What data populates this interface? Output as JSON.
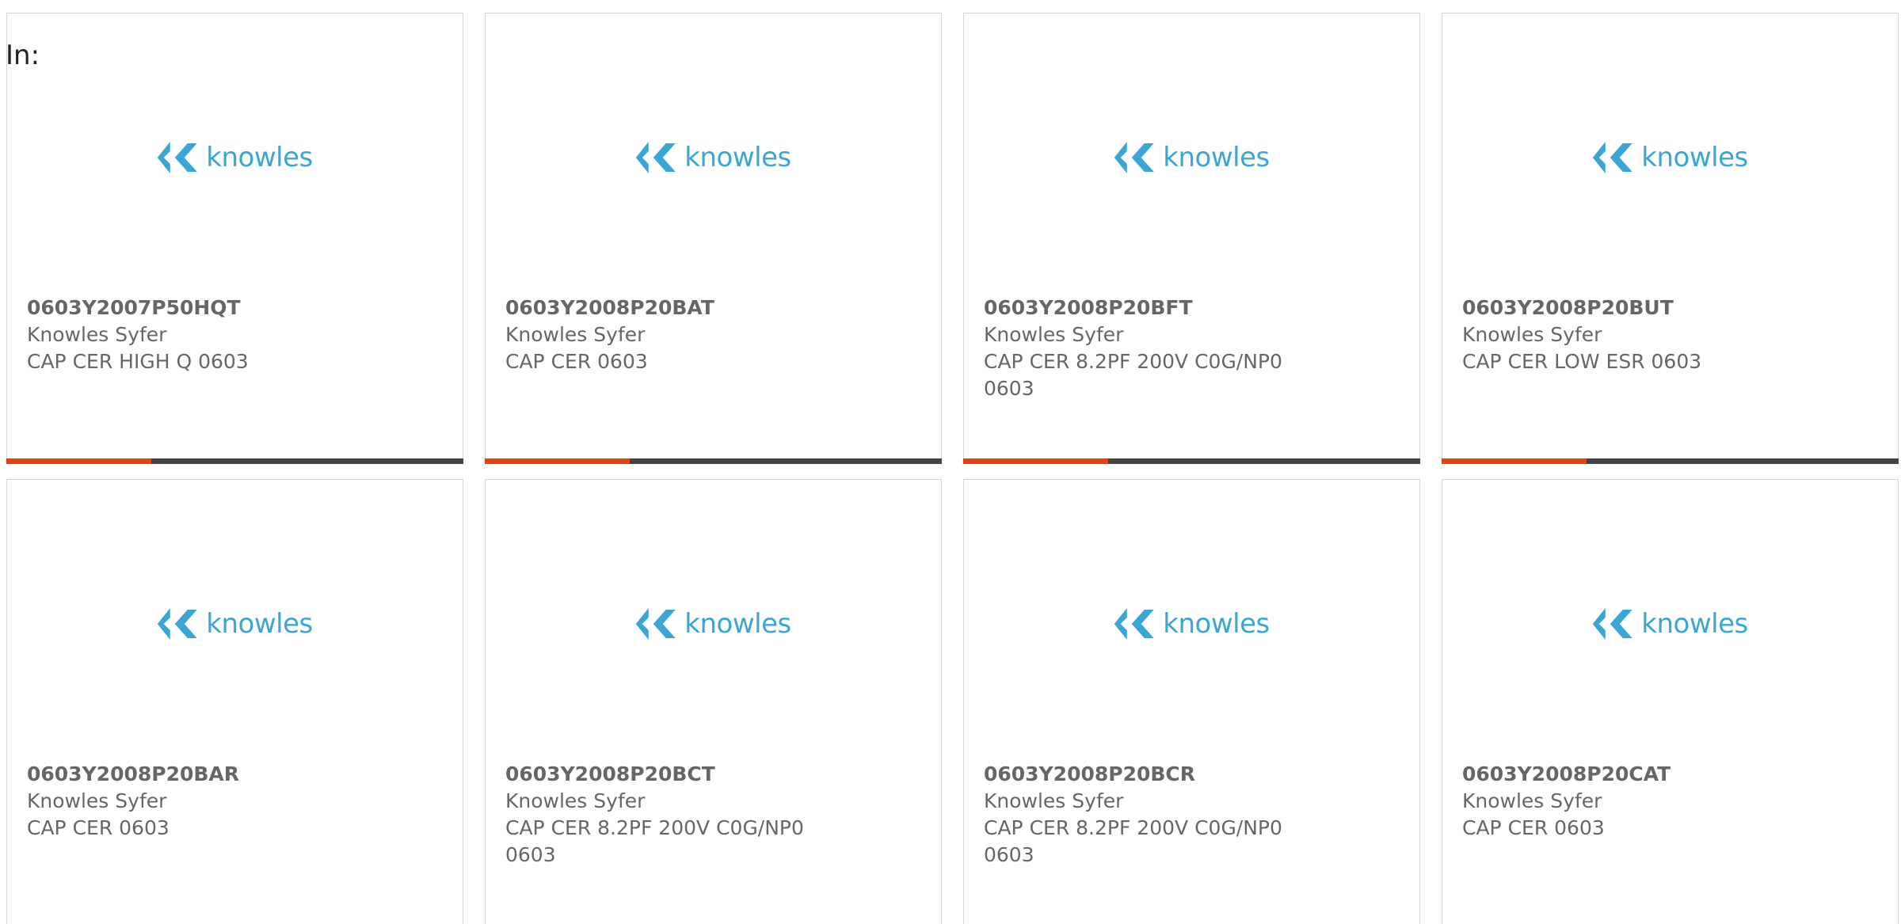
{
  "page": {
    "label": "In:"
  },
  "brand": {
    "logo_text": "knowles",
    "logo_color": "#3aa6d6",
    "accent_color": "#e8400f",
    "bar_color": "#444444"
  },
  "cards": [
    {
      "part": "0603Y2007P50HQT",
      "manufacturer": "Knowles Syfer",
      "description": "CAP CER HIGH Q 0603"
    },
    {
      "part": "0603Y2008P20BAT",
      "manufacturer": "Knowles Syfer",
      "description": "CAP CER 0603"
    },
    {
      "part": "0603Y2008P20BFT",
      "manufacturer": "Knowles Syfer",
      "description": "CAP CER 8.2PF 200V C0G/NP0 0603"
    },
    {
      "part": "0603Y2008P20BUT",
      "manufacturer": "Knowles Syfer",
      "description": "CAP CER LOW ESR 0603"
    },
    {
      "part": "0603Y2008P20BAR",
      "manufacturer": "Knowles Syfer",
      "description": "CAP CER 0603"
    },
    {
      "part": "0603Y2008P20BCT",
      "manufacturer": "Knowles Syfer",
      "description": "CAP CER 8.2PF 200V C0G/NP0 0603"
    },
    {
      "part": "0603Y2008P20BCR",
      "manufacturer": "Knowles Syfer",
      "description": "CAP CER 8.2PF 200V C0G/NP0 0603"
    },
    {
      "part": "0603Y2008P20CAT",
      "manufacturer": "Knowles Syfer",
      "description": "CAP CER 0603"
    }
  ]
}
